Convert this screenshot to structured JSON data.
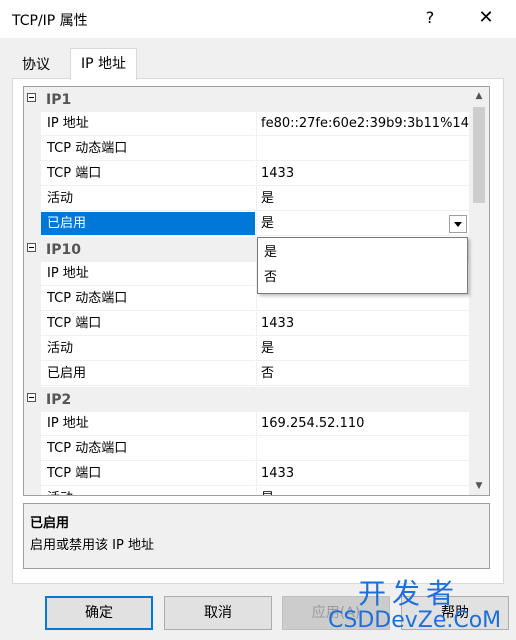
{
  "window": {
    "title": "TCP/IP 属性",
    "help_glyph": "?",
    "close_glyph": "✕"
  },
  "tabs": [
    {
      "label": "协议",
      "active": false
    },
    {
      "label": "IP 地址",
      "active": true
    }
  ],
  "grid": {
    "sections": [
      {
        "label": "IP1",
        "rows": [
          {
            "name": "IP 地址",
            "value": "fe80::27fe:60e2:39b9:3b11%14"
          },
          {
            "name": "TCP 动态端口",
            "value": ""
          },
          {
            "name": "TCP 端口",
            "value": "1433"
          },
          {
            "name": "活动",
            "value": "是"
          },
          {
            "name": "已启用",
            "value": "是",
            "selected": true
          }
        ]
      },
      {
        "label": "IP10",
        "rows": [
          {
            "name": "IP 地址",
            "value": ""
          },
          {
            "name": "TCP 动态端口",
            "value": ""
          },
          {
            "name": "TCP 端口",
            "value": "1433"
          },
          {
            "name": "活动",
            "value": "是"
          },
          {
            "name": "已启用",
            "value": "否"
          }
        ]
      },
      {
        "label": "IP2",
        "rows": [
          {
            "name": "IP 地址",
            "value": "169.254.52.110"
          },
          {
            "name": "TCP 动态端口",
            "value": ""
          },
          {
            "name": "TCP 端口",
            "value": "1433"
          },
          {
            "name": "活动",
            "value": "是"
          }
        ]
      }
    ],
    "dropdown_options": [
      "是",
      "否"
    ]
  },
  "description": {
    "title": "已启用",
    "text": "启用或禁用该 IP 地址"
  },
  "buttons": {
    "ok": "确定",
    "cancel": "取消",
    "apply": "应用(A)",
    "help": "帮助"
  },
  "watermark": {
    "line1": "开发者",
    "line2": "CSDDevZe.CoM"
  },
  "colors": {
    "selection": "#0078d7",
    "watermark": "#1e6fd8"
  }
}
